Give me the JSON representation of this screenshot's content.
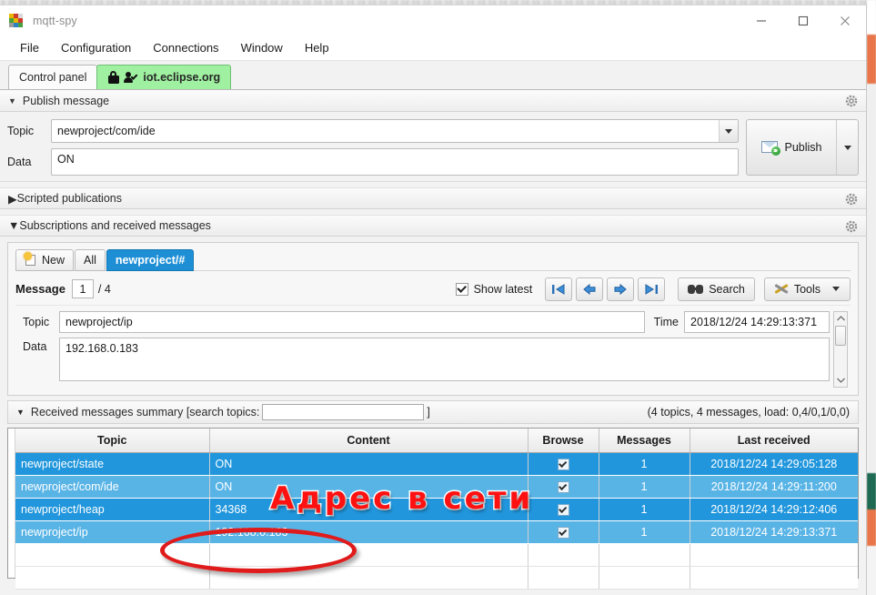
{
  "window": {
    "title": "mqtt-spy",
    "app_icon": "mqtt-spy-icon",
    "minimize_label": "Minimize",
    "maximize_label": "Maximize",
    "close_label": "Close"
  },
  "menubar": {
    "items": [
      {
        "label": "File"
      },
      {
        "label": "Configuration"
      },
      {
        "label": "Connections"
      },
      {
        "label": "Window"
      },
      {
        "label": "Help"
      }
    ]
  },
  "tabs": [
    {
      "label": "Control panel",
      "active": false
    },
    {
      "label": "iot.eclipse.org",
      "active": true
    }
  ],
  "publish_pane": {
    "title": "Publish message",
    "topic_label": "Topic",
    "topic_value": "newproject/com/ide",
    "data_label": "Data",
    "data_value": "ON",
    "publish_label": "Publish",
    "settings_icon": "gear-icon"
  },
  "scripted_pane": {
    "title": "Scripted publications",
    "settings_icon": "gear-icon"
  },
  "subscriptions_pane": {
    "title": "Subscriptions and received messages",
    "settings_icon": "gear-icon",
    "tabs": [
      {
        "label": "New",
        "selected": false,
        "icon": "new-page-icon"
      },
      {
        "label": "All",
        "selected": false
      },
      {
        "label": "newproject/#",
        "selected": true
      }
    ],
    "message_label": "Message",
    "message_index": "1",
    "message_total": "/ 4",
    "show_latest_label": "Show latest",
    "show_latest_checked": true,
    "nav_buttons": [
      {
        "name": "first",
        "icon": "skip-back-icon"
      },
      {
        "name": "previous",
        "icon": "arrow-left-icon"
      },
      {
        "name": "next",
        "icon": "arrow-right-icon"
      },
      {
        "name": "last",
        "icon": "skip-forward-icon"
      }
    ],
    "search_label": "Search",
    "tools_label": "Tools"
  },
  "message_detail": {
    "topic_label": "Topic",
    "topic_value": "newproject/ip",
    "time_label": "Time",
    "time_value": "2018/12/24 14:29:13:371",
    "data_label": "Data",
    "data_value": "192.168.0.183"
  },
  "summary": {
    "title": "Received messages summary [search topics:",
    "title_close": "]",
    "search_value": "",
    "search_placeholder": "",
    "stats": "(4 topics, 4 messages, load: 0,4/0,1/0,0)"
  },
  "table": {
    "columns": [
      "Topic",
      "Content",
      "Browse",
      "Messages",
      "Last received"
    ],
    "rows": [
      {
        "topic": "newproject/state",
        "content": "ON",
        "browse": true,
        "messages": "1",
        "last_received": "2018/12/24 14:29:05:128"
      },
      {
        "topic": "newproject/com/ide",
        "content": "ON",
        "browse": true,
        "messages": "1",
        "last_received": "2018/12/24 14:29:11:200"
      },
      {
        "topic": "newproject/heap",
        "content": "34368",
        "browse": true,
        "messages": "1",
        "last_received": "2018/12/24 14:29:12:406"
      },
      {
        "topic": "newproject/ip",
        "content": "192.168.0.183",
        "browse": true,
        "messages": "1",
        "last_received": "2018/12/24 14:29:13:371"
      }
    ]
  },
  "annotations": {
    "text": "Адрес в сети",
    "text_color": "#ff1111",
    "outline_color": "#ffffff",
    "ellipse_color": "#e01b1b"
  },
  "colors": {
    "tab_active_bg": "#9ff0a0",
    "subtab_selected_bg": "#1e8fd5",
    "row_dark": "#2196dc",
    "row_light": "#59b4e6"
  }
}
